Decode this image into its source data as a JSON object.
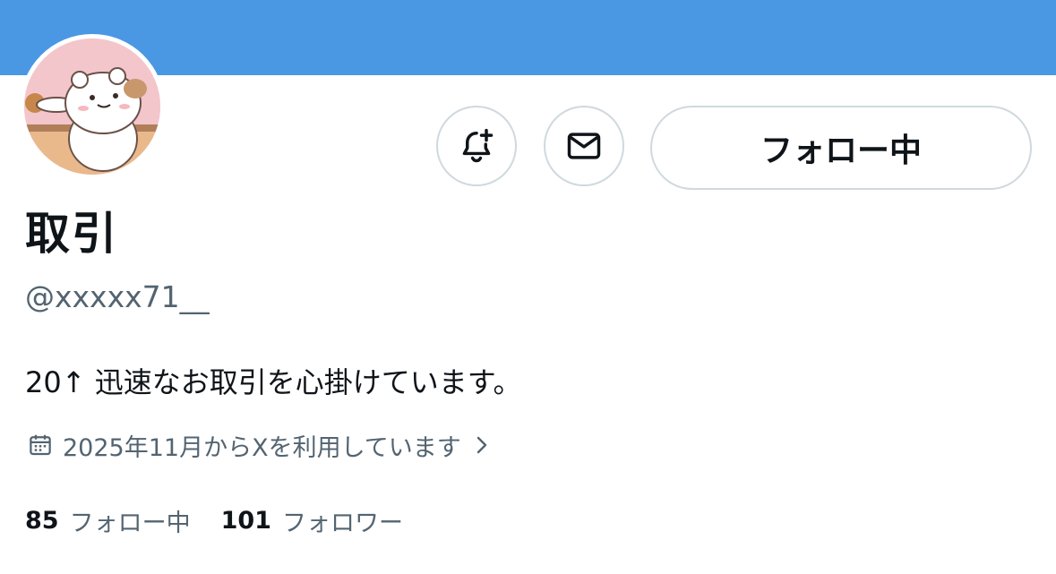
{
  "profile": {
    "display_name": "取引",
    "handle": "@xxxxx71__",
    "bio": "20↑ 迅速なお取引を心掛けています。",
    "joined": "2025年11月からXを利用しています",
    "banner_color": "#4a98e3"
  },
  "actions": {
    "follow_label": "フォロー中",
    "notify_icon": "bell-plus-icon",
    "message_icon": "envelope-icon"
  },
  "stats": {
    "following_count": "85",
    "following_label": "フォロー中",
    "followers_count": "101",
    "followers_label": "フォロワー"
  }
}
